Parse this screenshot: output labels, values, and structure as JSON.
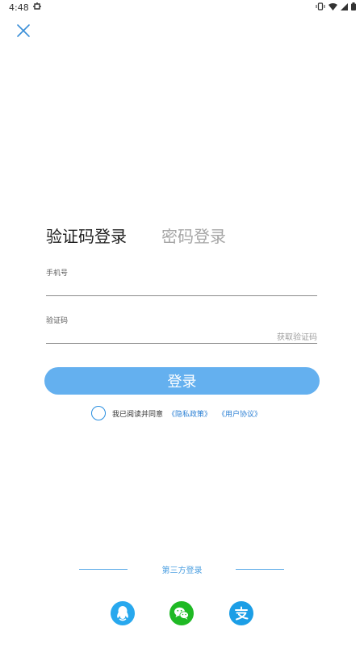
{
  "status_bar": {
    "time": "4:48",
    "icons": [
      "notification-bug-icon",
      "vibrate-icon",
      "wifi-icon",
      "signal-icon",
      "battery-icon"
    ]
  },
  "header": {
    "close_icon": "close-icon"
  },
  "tabs": [
    {
      "label": "验证码登录",
      "active": true
    },
    {
      "label": "密码登录",
      "active": false
    }
  ],
  "form": {
    "phone_label": "手机号",
    "phone_value": "",
    "code_label": "验证码",
    "code_value": "",
    "get_code_label": "获取验证码"
  },
  "login_button_label": "登录",
  "agreement": {
    "text": "我已阅读并同意",
    "privacy_link": "《隐私政策》",
    "user_link": "《用户协议》",
    "checked": false
  },
  "third_party": {
    "label": "第三方登录",
    "providers": [
      "qq-icon",
      "wechat-icon",
      "alipay-icon"
    ]
  },
  "colors": {
    "accent": "#64b0ef",
    "link": "#2a7fd4",
    "wechat": "#1fb924",
    "qq": "#28a8ee",
    "alipay": "#1c9ee6"
  }
}
